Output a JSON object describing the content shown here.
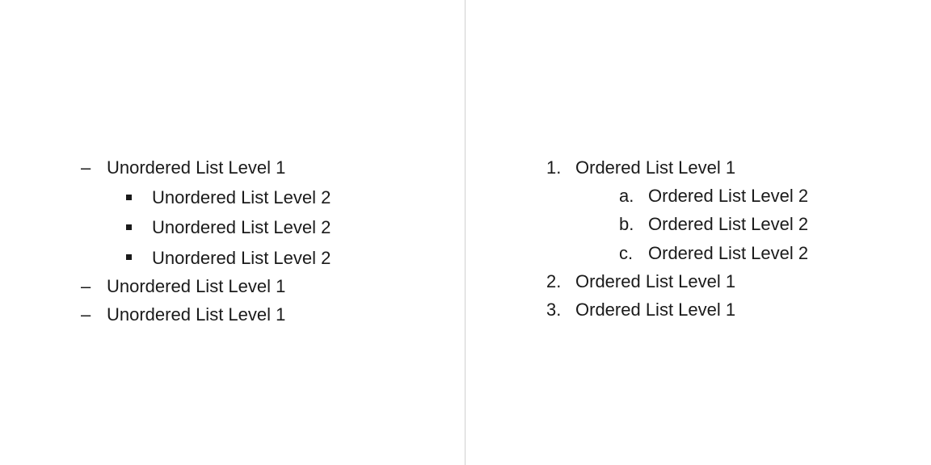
{
  "unordered": {
    "level1": [
      "Unordered List Level 1",
      "Unordered List Level 1",
      "Unordered List Level 1"
    ],
    "level2": [
      "Unordered List Level 2",
      "Unordered List Level 2",
      "Unordered List Level 2"
    ]
  },
  "ordered": {
    "level1_markers": [
      "1.",
      "2.",
      "3."
    ],
    "level1": [
      "Ordered List Level 1",
      "Ordered List Level 1",
      "Ordered List Level 1"
    ],
    "level2_markers": [
      "a.",
      "b.",
      "c."
    ],
    "level2": [
      "Ordered List Level 2",
      "Ordered List Level 2",
      "Ordered List Level 2"
    ]
  }
}
